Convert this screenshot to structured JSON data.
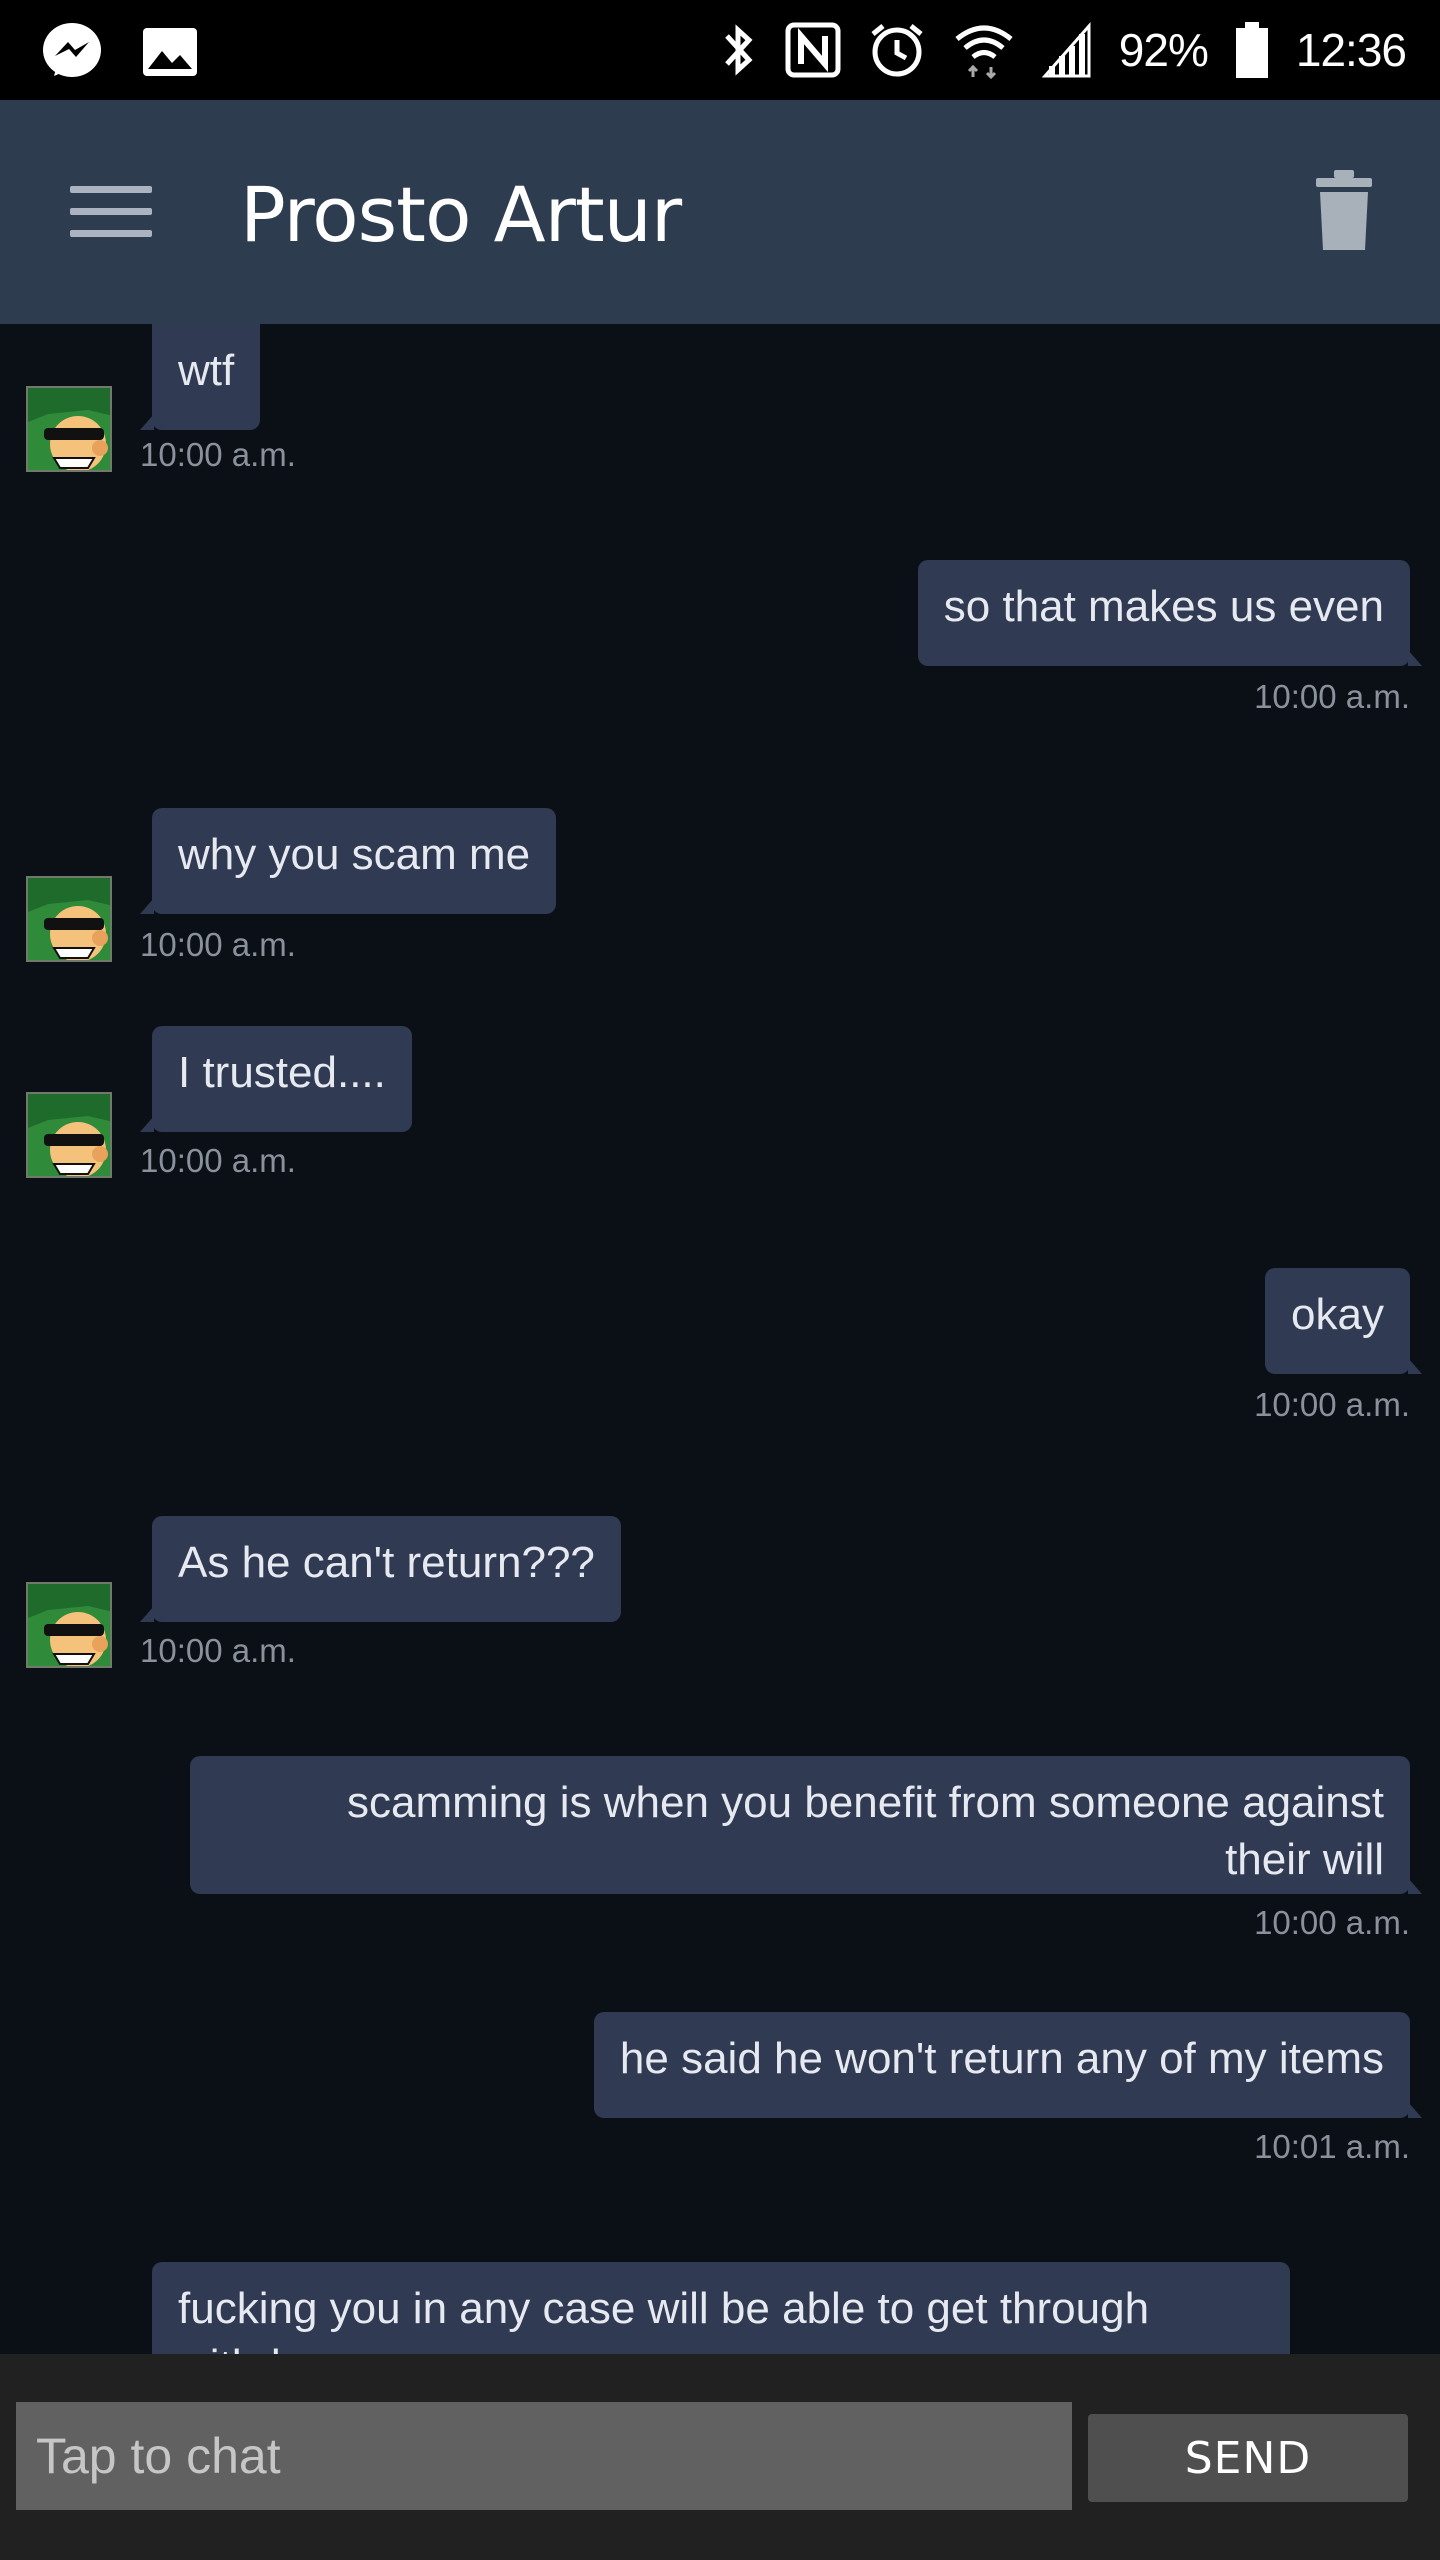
{
  "status_bar": {
    "battery_pct": "92%",
    "clock": "12:36"
  },
  "header": {
    "title": "Prosto Artur"
  },
  "messages": [
    {
      "direction": "in",
      "text": "wtf",
      "time": "10:00 a.m."
    },
    {
      "direction": "out",
      "text": "so that makes us even",
      "time": "10:00 a.m."
    },
    {
      "direction": "in",
      "text": "why you scam me",
      "time": "10:00 a.m."
    },
    {
      "direction": "in",
      "text": "I trusted....",
      "time": "10:00 a.m."
    },
    {
      "direction": "out",
      "text": "okay",
      "time": "10:00 a.m."
    },
    {
      "direction": "in",
      "text": "As he can't return???",
      "time": "10:00 a.m."
    },
    {
      "direction": "out",
      "text_line1": "scamming is when you benefit from someone against",
      "text_line2": "their will",
      "time": "10:00 a.m."
    },
    {
      "direction": "out",
      "text": "he said he won't return any of my items",
      "time": "10:01 a.m."
    },
    {
      "direction": "in",
      "text": "fucking you in any case will be able to get through withdraw"
    }
  ],
  "input": {
    "placeholder": "Tap to chat",
    "send_label": "SEND"
  },
  "colors": {
    "app_bar": "#2e3c50",
    "chat_bg": "#0b1017",
    "bubble": "#303a52",
    "input_bar": "#212121"
  }
}
